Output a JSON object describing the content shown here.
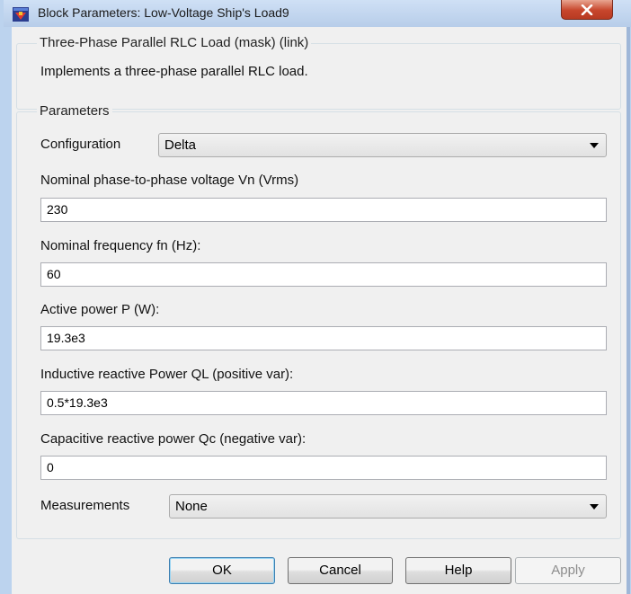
{
  "window": {
    "title": "Block Parameters: Low-Voltage Ship's Load9",
    "close_label": "X"
  },
  "mask": {
    "group_title": "Three-Phase Parallel RLC Load (mask) (link)",
    "description": "Implements a three-phase parallel RLC load."
  },
  "params": {
    "group_title": "Parameters",
    "configuration": {
      "label": "Configuration",
      "value": "Delta"
    },
    "voltage": {
      "label": "Nominal phase-to-phase voltage Vn (Vrms)",
      "value": "230"
    },
    "frequency": {
      "label": "Nominal frequency fn (Hz):",
      "value": "60"
    },
    "active_power": {
      "label": "Active power P (W):",
      "value": "19.3e3"
    },
    "inductive_power": {
      "label": "Inductive reactive Power QL (positive var):",
      "value": "0.5*19.3e3"
    },
    "capacitive_power": {
      "label": "Capacitive reactive power Qc (negative var):",
      "value": "0"
    },
    "measurements": {
      "label": "Measurements",
      "value": "None"
    }
  },
  "buttons": {
    "ok": "OK",
    "cancel": "Cancel",
    "help": "Help",
    "apply": "Apply"
  },
  "icons": {
    "title_icon": "simulink-block-icon",
    "close_icon": "close-icon",
    "dropdown_icon": "chevron-down-icon"
  }
}
